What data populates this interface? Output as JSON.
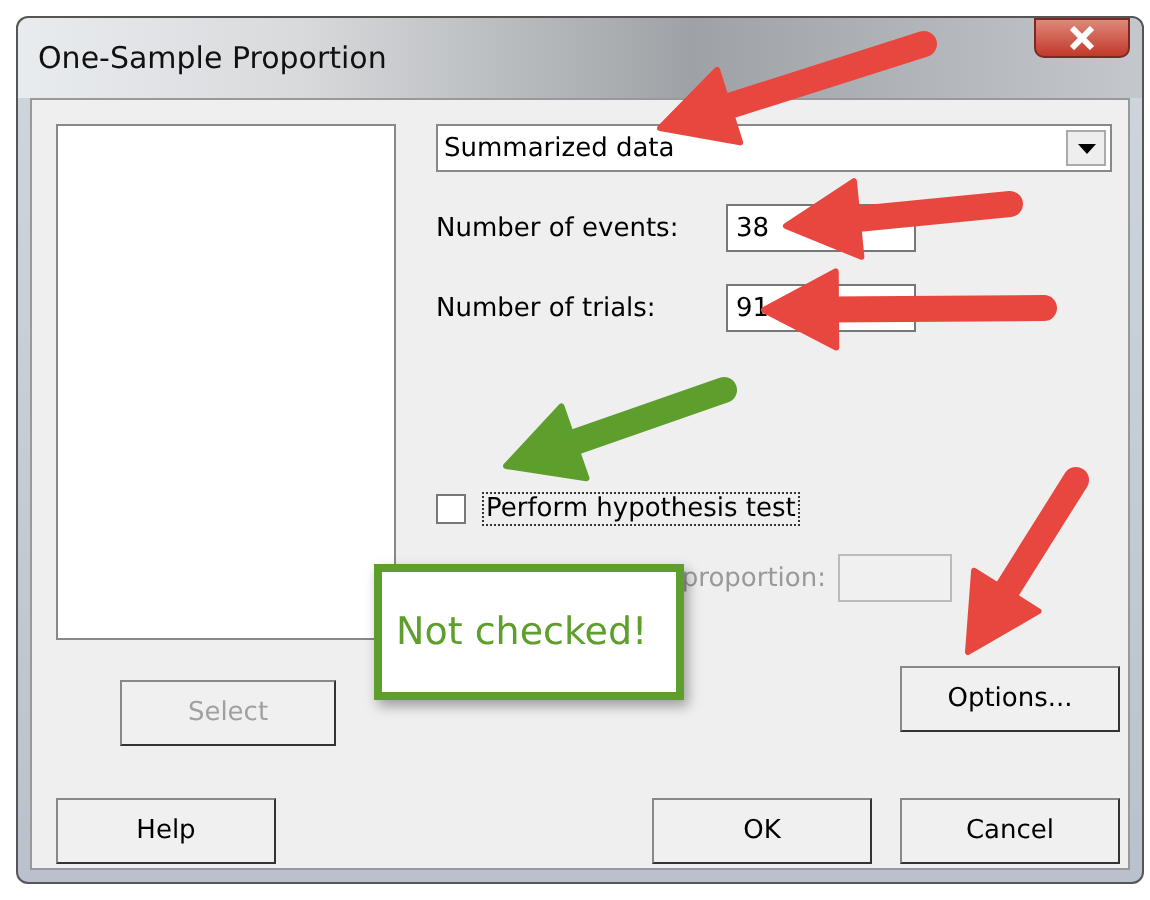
{
  "window": {
    "title": "One-Sample Proportion"
  },
  "data_source": {
    "value": "Summarized data"
  },
  "fields": [
    {
      "label": "Number of events:",
      "value": "38"
    },
    {
      "label": "Number of trials:",
      "value": "91"
    }
  ],
  "hypothesis_test": {
    "label": "Perform hypothesis test",
    "checked": false
  },
  "hypothesized_proportion": {
    "label": "proportion:",
    "disabled": true
  },
  "select_button": {
    "label": "Select",
    "disabled": true
  },
  "options_button": {
    "label": "Options..."
  },
  "buttons": [
    {
      "label": "Help"
    },
    {
      "label": "OK"
    },
    {
      "label": "Cancel"
    }
  ],
  "callout": {
    "text": "Not checked!",
    "color": "#5d9e2c"
  },
  "arrows": [
    {
      "color": "#e8473f"
    },
    {
      "color": "#e8473f"
    },
    {
      "color": "#e8473f"
    },
    {
      "color": "#5d9e2c"
    },
    {
      "color": "#e8473f"
    }
  ]
}
